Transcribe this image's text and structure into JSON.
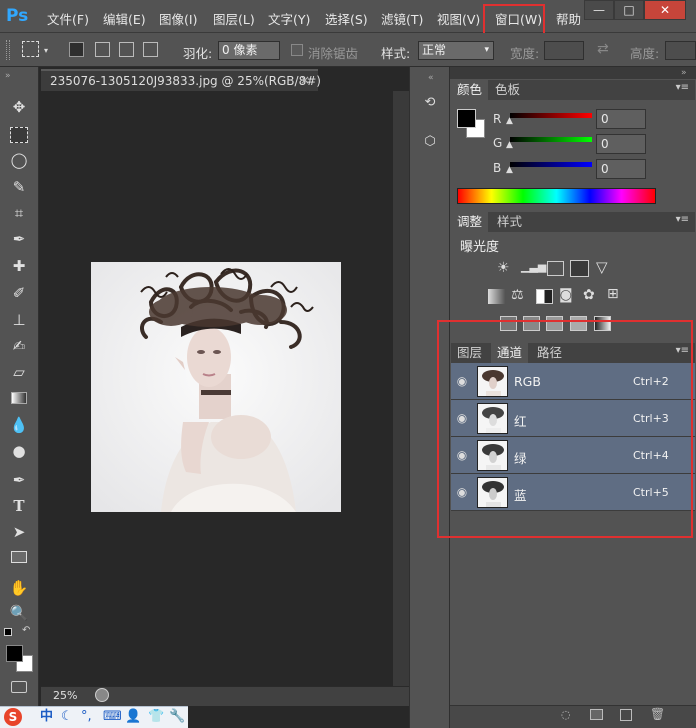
{
  "app": {
    "logo": "Ps"
  },
  "menu": {
    "items": [
      "文件(F)",
      "编辑(E)",
      "图像(I)",
      "图层(L)",
      "文字(Y)",
      "选择(S)",
      "滤镜(T)",
      "视图(V)",
      "窗口(W)",
      "帮助"
    ]
  },
  "window_controls": {
    "minimize": "—",
    "maximize": "□",
    "close": "✕"
  },
  "options": {
    "feather_label": "羽化:",
    "feather_value": "0 像素",
    "antialias_label": "消除锯齿",
    "style_label": "样式:",
    "style_value": "正常",
    "width_label": "宽度:",
    "height_label": "高度:"
  },
  "document": {
    "tab_title": "235076-1305120J93833.jpg @ 25%(RGB/8#)",
    "tab_close": "×",
    "zoom": "25%"
  },
  "color_panel": {
    "tabs": [
      "颜色",
      "色板"
    ],
    "channels": [
      {
        "label": "R",
        "value": "0"
      },
      {
        "label": "G",
        "value": "0"
      },
      {
        "label": "B",
        "value": "0"
      }
    ]
  },
  "adjustments_panel": {
    "tabs": [
      "调整",
      "样式"
    ],
    "heading": "曝光度"
  },
  "layers_panel": {
    "tabs": [
      "图层",
      "通道",
      "路径"
    ],
    "channels": [
      {
        "name": "RGB",
        "shortcut": "Ctrl+2"
      },
      {
        "name": "红",
        "shortcut": "Ctrl+3"
      },
      {
        "name": "绿",
        "shortcut": "Ctrl+4"
      },
      {
        "name": "蓝",
        "shortcut": "Ctrl+5"
      }
    ]
  },
  "taskbar": {
    "ime_logo": "S",
    "ime_mode": "中"
  }
}
